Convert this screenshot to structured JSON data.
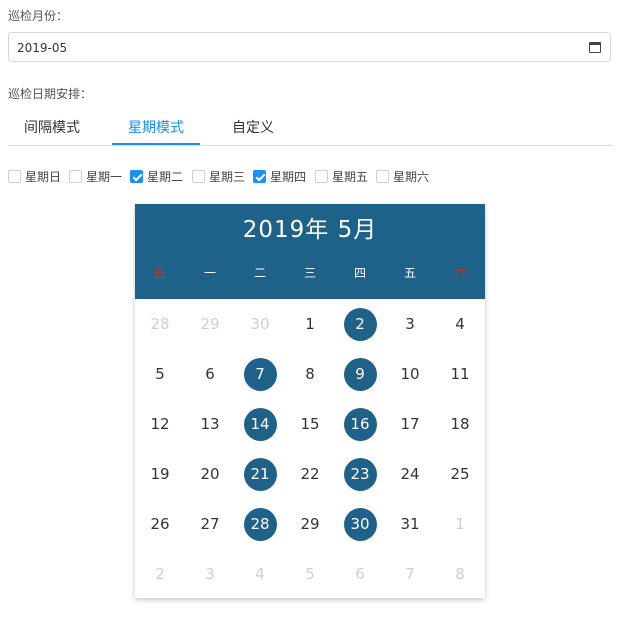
{
  "month_section": {
    "label": "巡检月份：",
    "value": "2019-05",
    "icon": "calendar-icon"
  },
  "schedule_section": {
    "label": "巡检日期安排："
  },
  "tabs": [
    {
      "label": "间隔模式",
      "active": false
    },
    {
      "label": "星期模式",
      "active": true
    },
    {
      "label": "自定义",
      "active": false
    }
  ],
  "weekday_options": [
    {
      "label": "星期日",
      "checked": false
    },
    {
      "label": "星期一",
      "checked": false
    },
    {
      "label": "星期二",
      "checked": true
    },
    {
      "label": "星期三",
      "checked": false
    },
    {
      "label": "星期四",
      "checked": true
    },
    {
      "label": "星期五",
      "checked": false
    },
    {
      "label": "星期六",
      "checked": false
    }
  ],
  "calendar": {
    "title": "2019年 5月",
    "header_color": "#1e6189",
    "weekend_color": "#c0392b",
    "weekday_headers": [
      "日",
      "一",
      "二",
      "三",
      "四",
      "五",
      "六"
    ],
    "weeks": [
      [
        {
          "d": "28",
          "m": true
        },
        {
          "d": "29",
          "m": true
        },
        {
          "d": "30",
          "m": true
        },
        {
          "d": "1"
        },
        {
          "d": "2",
          "s": true
        },
        {
          "d": "3"
        },
        {
          "d": "4"
        }
      ],
      [
        {
          "d": "5"
        },
        {
          "d": "6"
        },
        {
          "d": "7",
          "s": true
        },
        {
          "d": "8"
        },
        {
          "d": "9",
          "s": true
        },
        {
          "d": "10"
        },
        {
          "d": "11"
        }
      ],
      [
        {
          "d": "12"
        },
        {
          "d": "13"
        },
        {
          "d": "14",
          "s": true
        },
        {
          "d": "15"
        },
        {
          "d": "16",
          "s": true
        },
        {
          "d": "17"
        },
        {
          "d": "18"
        }
      ],
      [
        {
          "d": "19"
        },
        {
          "d": "20"
        },
        {
          "d": "21",
          "s": true
        },
        {
          "d": "22"
        },
        {
          "d": "23",
          "s": true
        },
        {
          "d": "24"
        },
        {
          "d": "25"
        }
      ],
      [
        {
          "d": "26"
        },
        {
          "d": "27"
        },
        {
          "d": "28",
          "s": true
        },
        {
          "d": "29"
        },
        {
          "d": "30",
          "s": true
        },
        {
          "d": "31"
        },
        {
          "d": "1",
          "m": true
        }
      ],
      [
        {
          "d": "2",
          "m": true
        },
        {
          "d": "3",
          "m": true
        },
        {
          "d": "4",
          "m": true
        },
        {
          "d": "5",
          "m": true
        },
        {
          "d": "6",
          "m": true
        },
        {
          "d": "7",
          "m": true
        },
        {
          "d": "8",
          "m": true
        }
      ]
    ]
  }
}
